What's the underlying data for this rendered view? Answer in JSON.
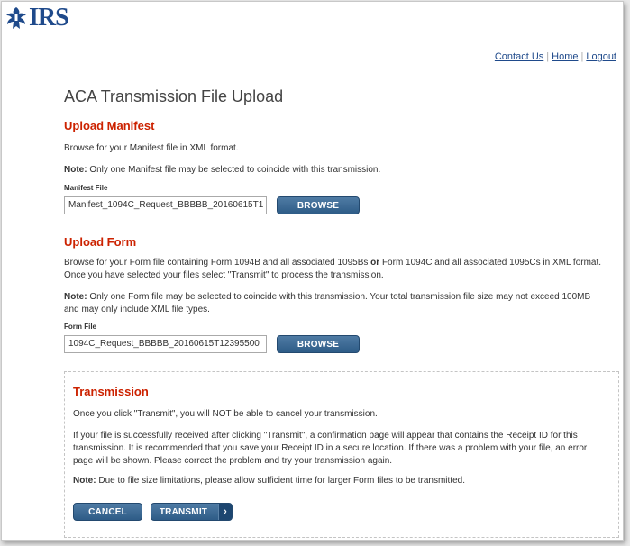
{
  "logo": {
    "text": "IRS"
  },
  "nav": {
    "contact": "Contact Us",
    "home": "Home",
    "logout": "Logout",
    "separator": "|"
  },
  "page": {
    "title": "ACA Transmission File Upload"
  },
  "manifest": {
    "heading": "Upload Manifest",
    "intro": "Browse for your Manifest file in XML format.",
    "note_label": "Note:",
    "note_text": " Only one Manifest file may be selected to coincide with this transmission.",
    "field_label": "Manifest File",
    "field_value": "Manifest_1094C_Request_BBBBB_20160615T1",
    "browse_label": "BROWSE"
  },
  "form": {
    "heading": "Upload Form",
    "intro_1": "Browse for your Form file containing Form 1094B and all associated 1095Bs ",
    "intro_or": "or",
    "intro_2": " Form 1094C and all associated 1095Cs in XML format. Once you have selected your files select \"Transmit\" to process the transmission.",
    "note_label": "Note:",
    "note_text": " Only one Form file may be selected to coincide with this transmission. Your total transmission file size may not exceed 100MB and may only include XML file types.",
    "field_label": "Form File",
    "field_value": "1094C_Request_BBBBB_20160615T12395500",
    "browse_label": "BROWSE"
  },
  "transmission": {
    "heading": "Transmission",
    "para1": "Once you click \"Transmit\", you will NOT be able to cancel your transmission.",
    "para2": "If your file is successfully received after clicking \"Transmit\", a confirmation page will appear that contains the Receipt ID for this transmission. It is recommended that you save your Receipt ID in a secure location. If there was a problem with your file, an error page will be shown. Please correct the problem and try your transmission again.",
    "note_label": "Note:",
    "note_text": " Due to file size limitations, please allow sufficient time for larger Form files to be transmitted.",
    "cancel_label": "CANCEL",
    "transmit_label": "TRANSMIT",
    "transmit_chevron": "›"
  },
  "colors": {
    "brand": "#1f4a8b",
    "heading_red": "#cc2200",
    "button": "#2e5c87"
  },
  "icons": {
    "logo": "irs-eagle-icon",
    "transmit": "chevron-right-icon"
  }
}
